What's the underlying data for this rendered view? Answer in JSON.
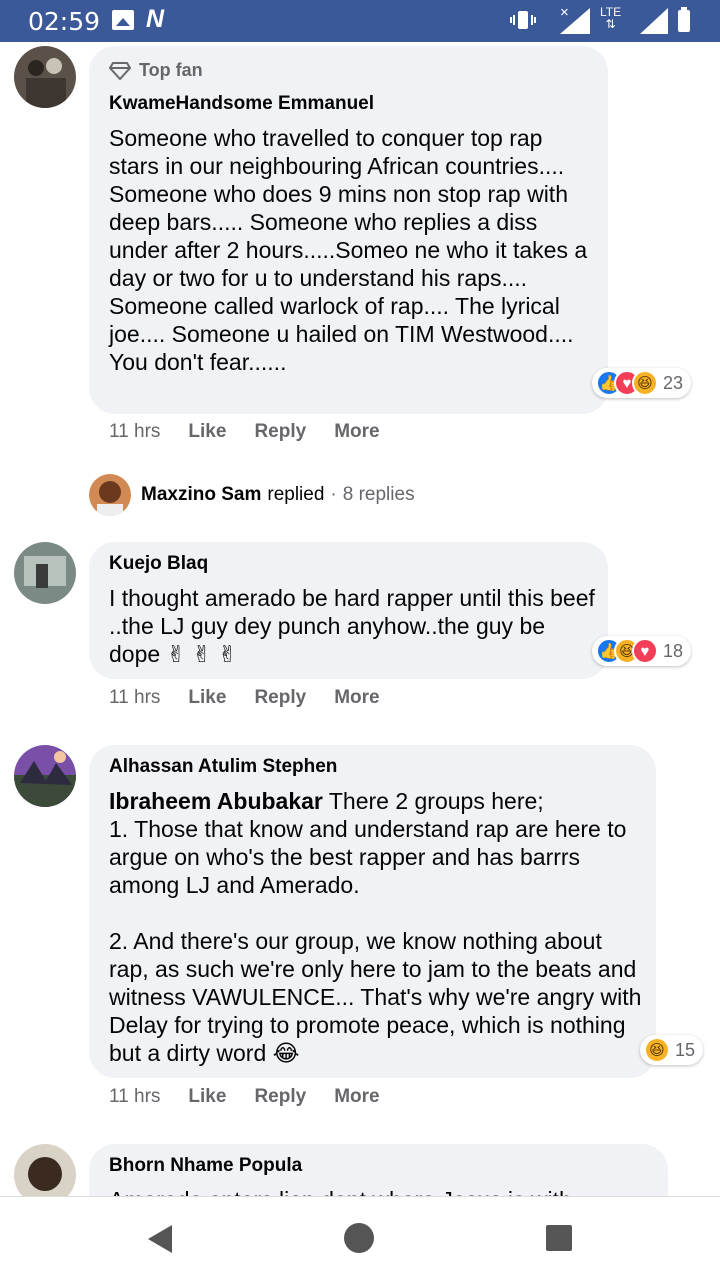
{
  "status_bar": {
    "time": "02:59",
    "network": "LTE",
    "x_mark": "×"
  },
  "comments": [
    {
      "badge": "Top fan",
      "author": "KwameHandsome Emmanuel",
      "text": "Someone who travelled to conquer top rap stars in our neighbouring African countries.... Someone who does 9 mins non stop rap with deep bars..... Someone who replies a diss under after 2 hours.....Someo ne who it takes a day or two for u to understand his raps.... Someone called warlock of rap.... The lyrical joe.... Someone u hailed on TIM Westwood.... You don't fear......",
      "reaction_count": "23",
      "time": "11 hrs"
    },
    {
      "author": "Kuejo Blaq",
      "text": "I thought amerado be hard rapper until this beef ..the LJ guy dey punch anyhow..the guy be dope ✌ ✌ ✌",
      "reaction_count": "18",
      "time": "11 hrs"
    },
    {
      "author": "Alhassan Atulim Stephen",
      "mention": "Ibraheem Abubakar",
      "text": " There 2 groups here;\n1. Those that know and understand rap are here to argue on who's the best rapper and has barrrs among LJ and Amerado.\n\n2. And there's our group, we know nothing about rap, as such we're only here to jam to the beats and witness VAWULENCE... That's why we're angry with Delay for trying to promote peace, which is nothing but a dirty word 😂",
      "reaction_count": "15",
      "time": "11 hrs"
    },
    {
      "author": "Bhorn Nhame Popula",
      "text": "Amerado enters lion dent where Jesus is with"
    }
  ],
  "reply_summary": {
    "name": "Maxzino Sam",
    "verb": "replied",
    "separator": "·",
    "count": "8 replies"
  },
  "actions": {
    "like": "Like",
    "reply": "Reply",
    "more": "More"
  },
  "colors": {
    "status_bar": "#3b5998",
    "bubble": "#f0f2f5",
    "like": "#1877f2",
    "love": "#f33e58",
    "haha": "#f7b125"
  }
}
